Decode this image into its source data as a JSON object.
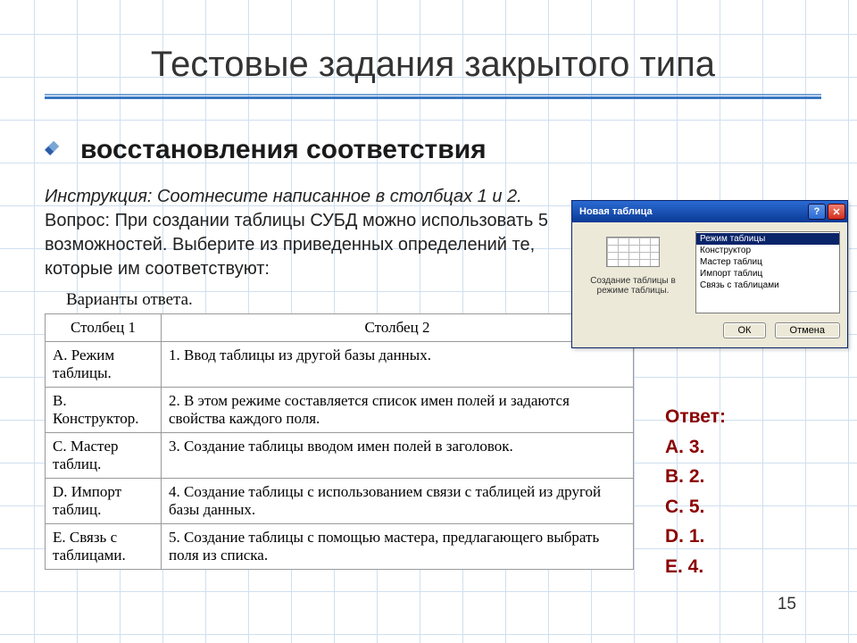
{
  "title": "Тестовые задания закрытого типа",
  "bullet": "восстановления соответствия",
  "instruction_line": "Инструкция: Соотнесите написанное в столбцах 1 и 2.",
  "question": "Вопрос: При создании таблицы СУБД можно использовать 5 возможностей. Выберите из приведенных определений те, которые им соответствуют:",
  "table_caption": "Варианты ответа.",
  "headers": {
    "col1": "Столбец 1",
    "col2": "Столбец 2"
  },
  "rows": [
    {
      "c1": "A. Режим таблицы.",
      "c2": "1. Ввод таблицы из другой базы данных."
    },
    {
      "c1": "B. Конструктор.",
      "c2": "2. В этом режиме составляется список имен полей и задаются свойства каждого поля."
    },
    {
      "c1": "C. Мастер таблиц.",
      "c2": "3. Создание таблицы вводом имен полей в заголовок."
    },
    {
      "c1": "D. Импорт таблиц.",
      "c2": "4. Создание таблицы с использованием связи с таблицей из другой базы данных."
    },
    {
      "c1": "E. Связь с таблицами.",
      "c2": "5. Создание таблицы с помощью мастера, предлагающего выбрать поля из списка."
    }
  ],
  "dialog": {
    "title": "Новая таблица",
    "preview_label": "Создание таблицы в режиме таблицы.",
    "list": [
      "Режим таблицы",
      "Конструктор",
      "Мастер таблиц",
      "Импорт таблиц",
      "Связь с таблицами"
    ],
    "ok": "ОК",
    "cancel": "Отмена"
  },
  "answers": {
    "label": "Ответ:",
    "items": [
      "A. 3.",
      "B. 2.",
      "C. 5.",
      "D. 1.",
      "E. 4."
    ]
  },
  "slide_number": "15"
}
